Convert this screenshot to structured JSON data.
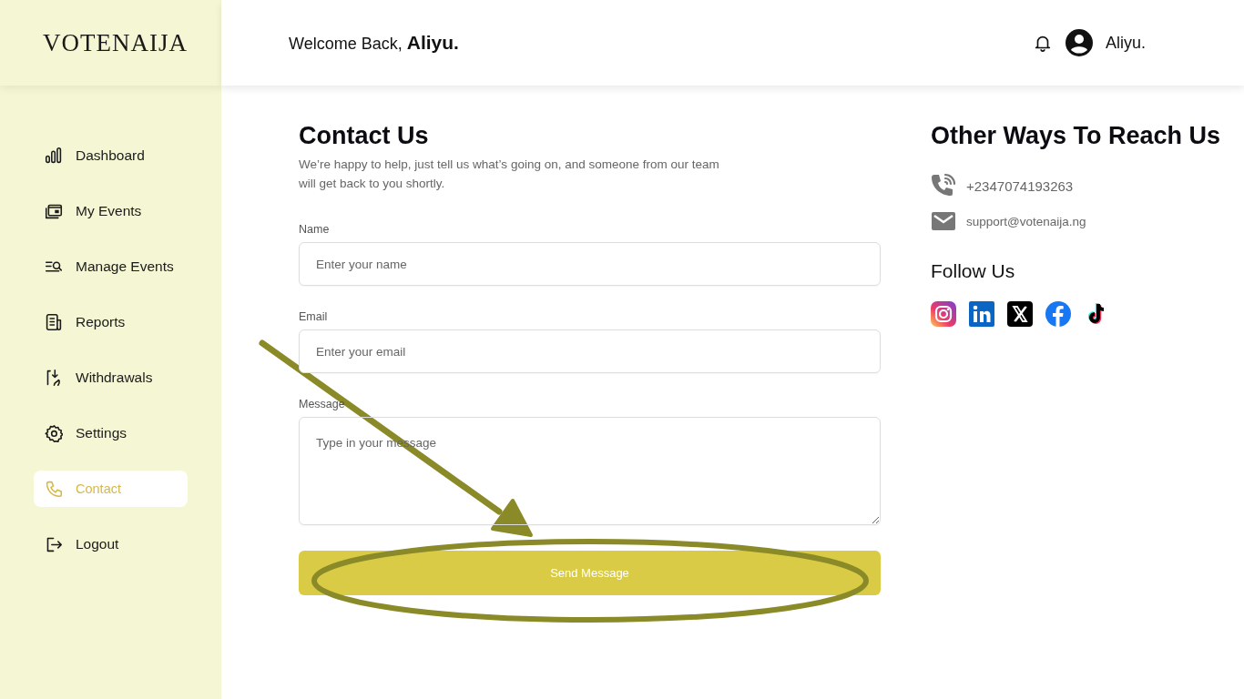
{
  "sidebar": {
    "logo": "VOTENAIJA",
    "items": [
      {
        "label": "Dashboard",
        "selected": false
      },
      {
        "label": "My Events",
        "selected": false
      },
      {
        "label": "Manage Events",
        "selected": false
      },
      {
        "label": "Reports",
        "selected": false
      },
      {
        "label": "Withdrawals",
        "selected": false
      },
      {
        "label": "Settings",
        "selected": false
      },
      {
        "label": "Contact",
        "selected": true
      },
      {
        "label": "Logout",
        "selected": false
      }
    ]
  },
  "header": {
    "welcome": "Welcome Back, **Aliyu.**",
    "user_name": "Aliyu."
  },
  "contact_form": {
    "title": "Contact Us",
    "subtitle": "We’re happy to help, just tell us what’s going on, and someone from our team will get back to you shortly.",
    "fields": [
      {
        "kind": "input",
        "label": "Name",
        "placeholder": "Enter your name"
      },
      {
        "kind": "input",
        "label": "Email",
        "placeholder": "Enter your email"
      },
      {
        "kind": "textarea",
        "label": "Message",
        "placeholder": "Type in your message"
      }
    ],
    "submit": "Send Message"
  },
  "reach": {
    "title": "Other Ways To Reach Us",
    "contacts": [
      {
        "kind": "phone",
        "text": "+2347074193263"
      },
      {
        "kind": "email",
        "text": "support@votenaija.ng"
      }
    ],
    "follow_title": "Follow Us"
  }
}
